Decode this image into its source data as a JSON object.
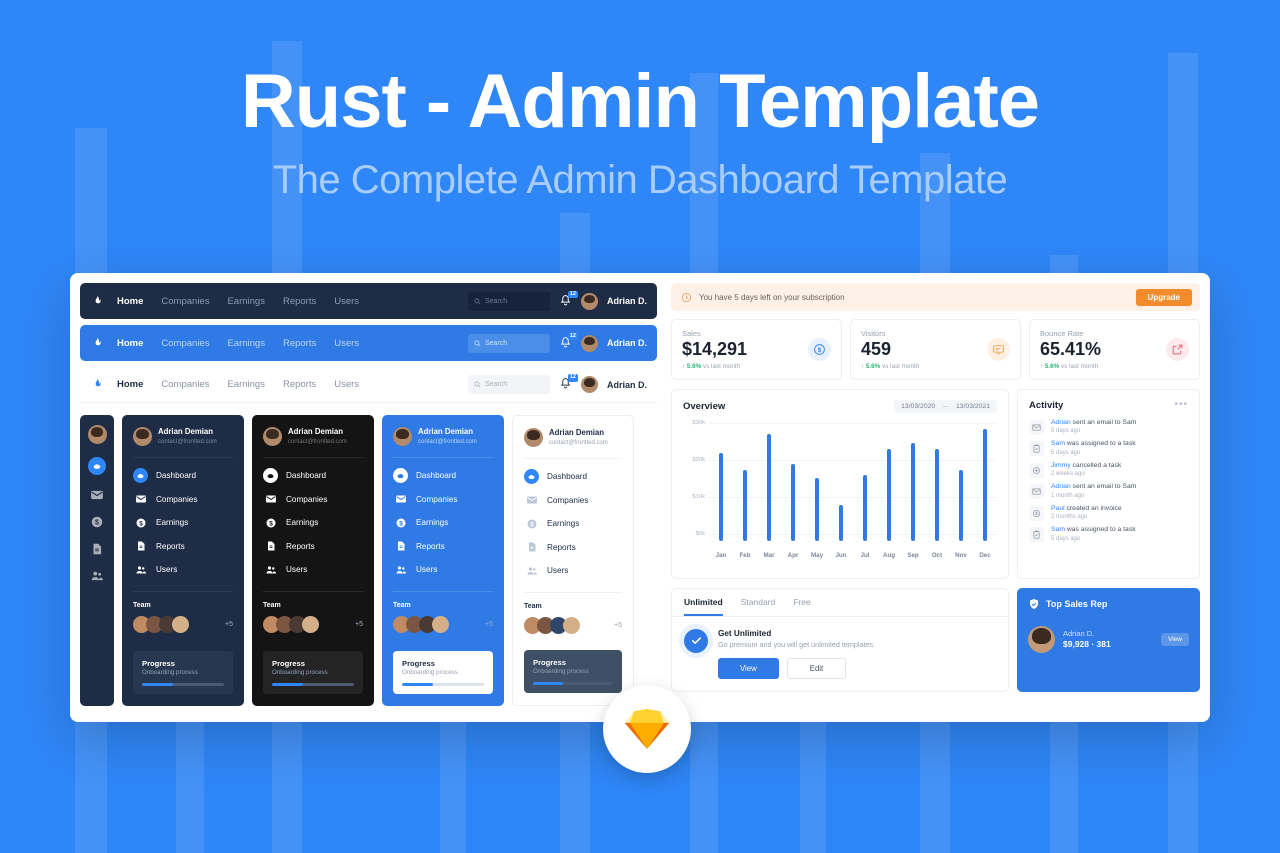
{
  "hero": {
    "title": "Rust - Admin Template",
    "subtitle": "The Complete Admin Dashboard Template"
  },
  "colors": {
    "background": "#2f86f6",
    "accent": "#2f7ae5",
    "dark_navy": "#1e2d45",
    "black": "#141414",
    "orange": "#f18b2c",
    "green": "#2bb673"
  },
  "navbars": [
    {
      "variant": "dark",
      "logo_icon": "flame-icon",
      "links": [
        "Home",
        "Companies",
        "Earnings",
        "Reports",
        "Users"
      ],
      "active_link": "Home",
      "search_placeholder": "Search",
      "notification_count": "12",
      "user_name": "Adrian D."
    },
    {
      "variant": "blue",
      "logo_icon": "flame-icon",
      "links": [
        "Home",
        "Companies",
        "Earnings",
        "Reports",
        "Users"
      ],
      "active_link": "Home",
      "search_placeholder": "Search",
      "notification_count": "12",
      "user_name": "Adrian D."
    },
    {
      "variant": "light",
      "logo_icon": "flame-icon",
      "links": [
        "Home",
        "Companies",
        "Earnings",
        "Reports",
        "Users"
      ],
      "active_link": "Home",
      "search_placeholder": "Search",
      "notification_count": "12",
      "user_name": "Adrian D."
    }
  ],
  "rail": {
    "icons": [
      "dashboard-icon",
      "mail-icon",
      "dollar-icon",
      "report-icon",
      "users-icon"
    ],
    "active_icon": "dashboard-icon"
  },
  "sidebars": [
    {
      "variant": "dark",
      "user_name": "Adrian Demian",
      "user_email": "contact@frontted.com",
      "items": [
        "Dashboard",
        "Companies",
        "Earnings",
        "Reports",
        "Users"
      ],
      "active_item": "Dashboard",
      "team_label": "Team",
      "team_more": "+5",
      "progress_title": "Progress",
      "progress_sub": "Onboarding process",
      "progress_percent": 38
    },
    {
      "variant": "black",
      "user_name": "Adrian Demian",
      "user_email": "contact@frontted.com",
      "items": [
        "Dashboard",
        "Companies",
        "Earnings",
        "Reports",
        "Users"
      ],
      "active_item": "Dashboard",
      "team_label": "Team",
      "team_more": "+5",
      "progress_title": "Progress",
      "progress_sub": "Onboarding process",
      "progress_percent": 38
    },
    {
      "variant": "blue",
      "user_name": "Adrian Demian",
      "user_email": "contact@frontted.com",
      "items": [
        "Dashboard",
        "Companies",
        "Earnings",
        "Reports",
        "Users"
      ],
      "active_item": "Dashboard",
      "team_label": "Team",
      "team_more": "+5",
      "progress_title": "Progress",
      "progress_sub": "Onboarding process",
      "progress_percent": 38
    },
    {
      "variant": "light",
      "user_name": "Adrian Demian",
      "user_email": "contact@frontted.com",
      "items": [
        "Dashboard",
        "Companies",
        "Earnings",
        "Reports",
        "Users"
      ],
      "active_item": "Dashboard",
      "team_label": "Team",
      "team_more": "+5",
      "progress_title": "Progress",
      "progress_sub": "Onboarding process",
      "progress_percent": 38
    }
  ],
  "alert": {
    "icon": "clock-icon",
    "text": "You have 5 days left on your subscription",
    "button_label": "Upgrade"
  },
  "stats": [
    {
      "label": "Sales",
      "value": "$14,291",
      "delta": "5.6%",
      "delta_suffix": "vs last month",
      "icon": "dollar-circle-icon",
      "icon_color": "#2f86f6",
      "icon_bg": "#e8f1fd"
    },
    {
      "label": "Visitors",
      "value": "459",
      "delta": "5.6%",
      "delta_suffix": "vs last month",
      "icon": "monitor-icon",
      "icon_color": "#f0a347",
      "icon_bg": "#fdf1e3"
    },
    {
      "label": "Bounce Rate",
      "value": "65.41%",
      "delta": "5.6%",
      "delta_suffix": "vs last month",
      "icon": "external-link-icon",
      "icon_color": "#e8636f",
      "icon_bg": "#fdeaec"
    }
  ],
  "chart_data": {
    "type": "bar",
    "title": "Overview",
    "categories": [
      "Jan",
      "Feb",
      "Mar",
      "Apr",
      "May",
      "Jun",
      "Jul",
      "Aug",
      "Sep",
      "Oct",
      "Nov",
      "Dec"
    ],
    "values": [
      24.5,
      19.8,
      29.8,
      21.5,
      17.5,
      10.0,
      18.3,
      25.7,
      27.3,
      25.6,
      19.8,
      31.2
    ],
    "ylabel": "",
    "xlabel": "",
    "ylim": [
      0,
      33
    ],
    "yticks": [
      0,
      10,
      20,
      30
    ],
    "ytick_labels": [
      "$0k",
      "$10k",
      "$20k",
      "$30k"
    ],
    "grid": true,
    "legend": false,
    "bar_color": "#2f7ae5",
    "date_from": "13/03/2020",
    "date_to": "13/03/2021"
  },
  "activity": {
    "title": "Activity",
    "menu_icon": "more-horizontal-icon",
    "items": [
      {
        "who": "Adrian",
        "action": "sent an email to Sam",
        "time": "5 days ago",
        "icon": "mail-icon"
      },
      {
        "who": "Sam",
        "action": "was assigned to a task",
        "time": "5 days ago",
        "icon": "clipboard-icon"
      },
      {
        "who": "Jimmy",
        "action": "cancelled a task",
        "time": "2 weeks ago",
        "icon": "settings-icon"
      },
      {
        "who": "Adrian",
        "action": "sent an email to Sam",
        "time": "1 month ago",
        "icon": "mail-icon"
      },
      {
        "who": "Paul",
        "action": "created an invoice",
        "time": "2 months ago",
        "icon": "dollar-icon"
      },
      {
        "who": "Sam",
        "action": "was assigned to a task",
        "time": "5 days ago",
        "icon": "clipboard-icon"
      }
    ]
  },
  "plans": {
    "tabs": [
      "Unlimited",
      "Standard",
      "Free"
    ],
    "active_tab": "Unlimited",
    "promo_icon": "check-circle-icon",
    "promo_title": "Get Unlimited",
    "promo_sub": "Go premium and you will get unlimited templates",
    "primary_button": "View",
    "secondary_button": "Edit"
  },
  "top_rep": {
    "icon": "shield-icon",
    "title": "Top Sales Rep",
    "name": "Adrian D.",
    "stats": "$9,928  ·  381",
    "button_label": "View"
  },
  "sketch_badge": {
    "icon": "sketch-diamond-icon"
  }
}
